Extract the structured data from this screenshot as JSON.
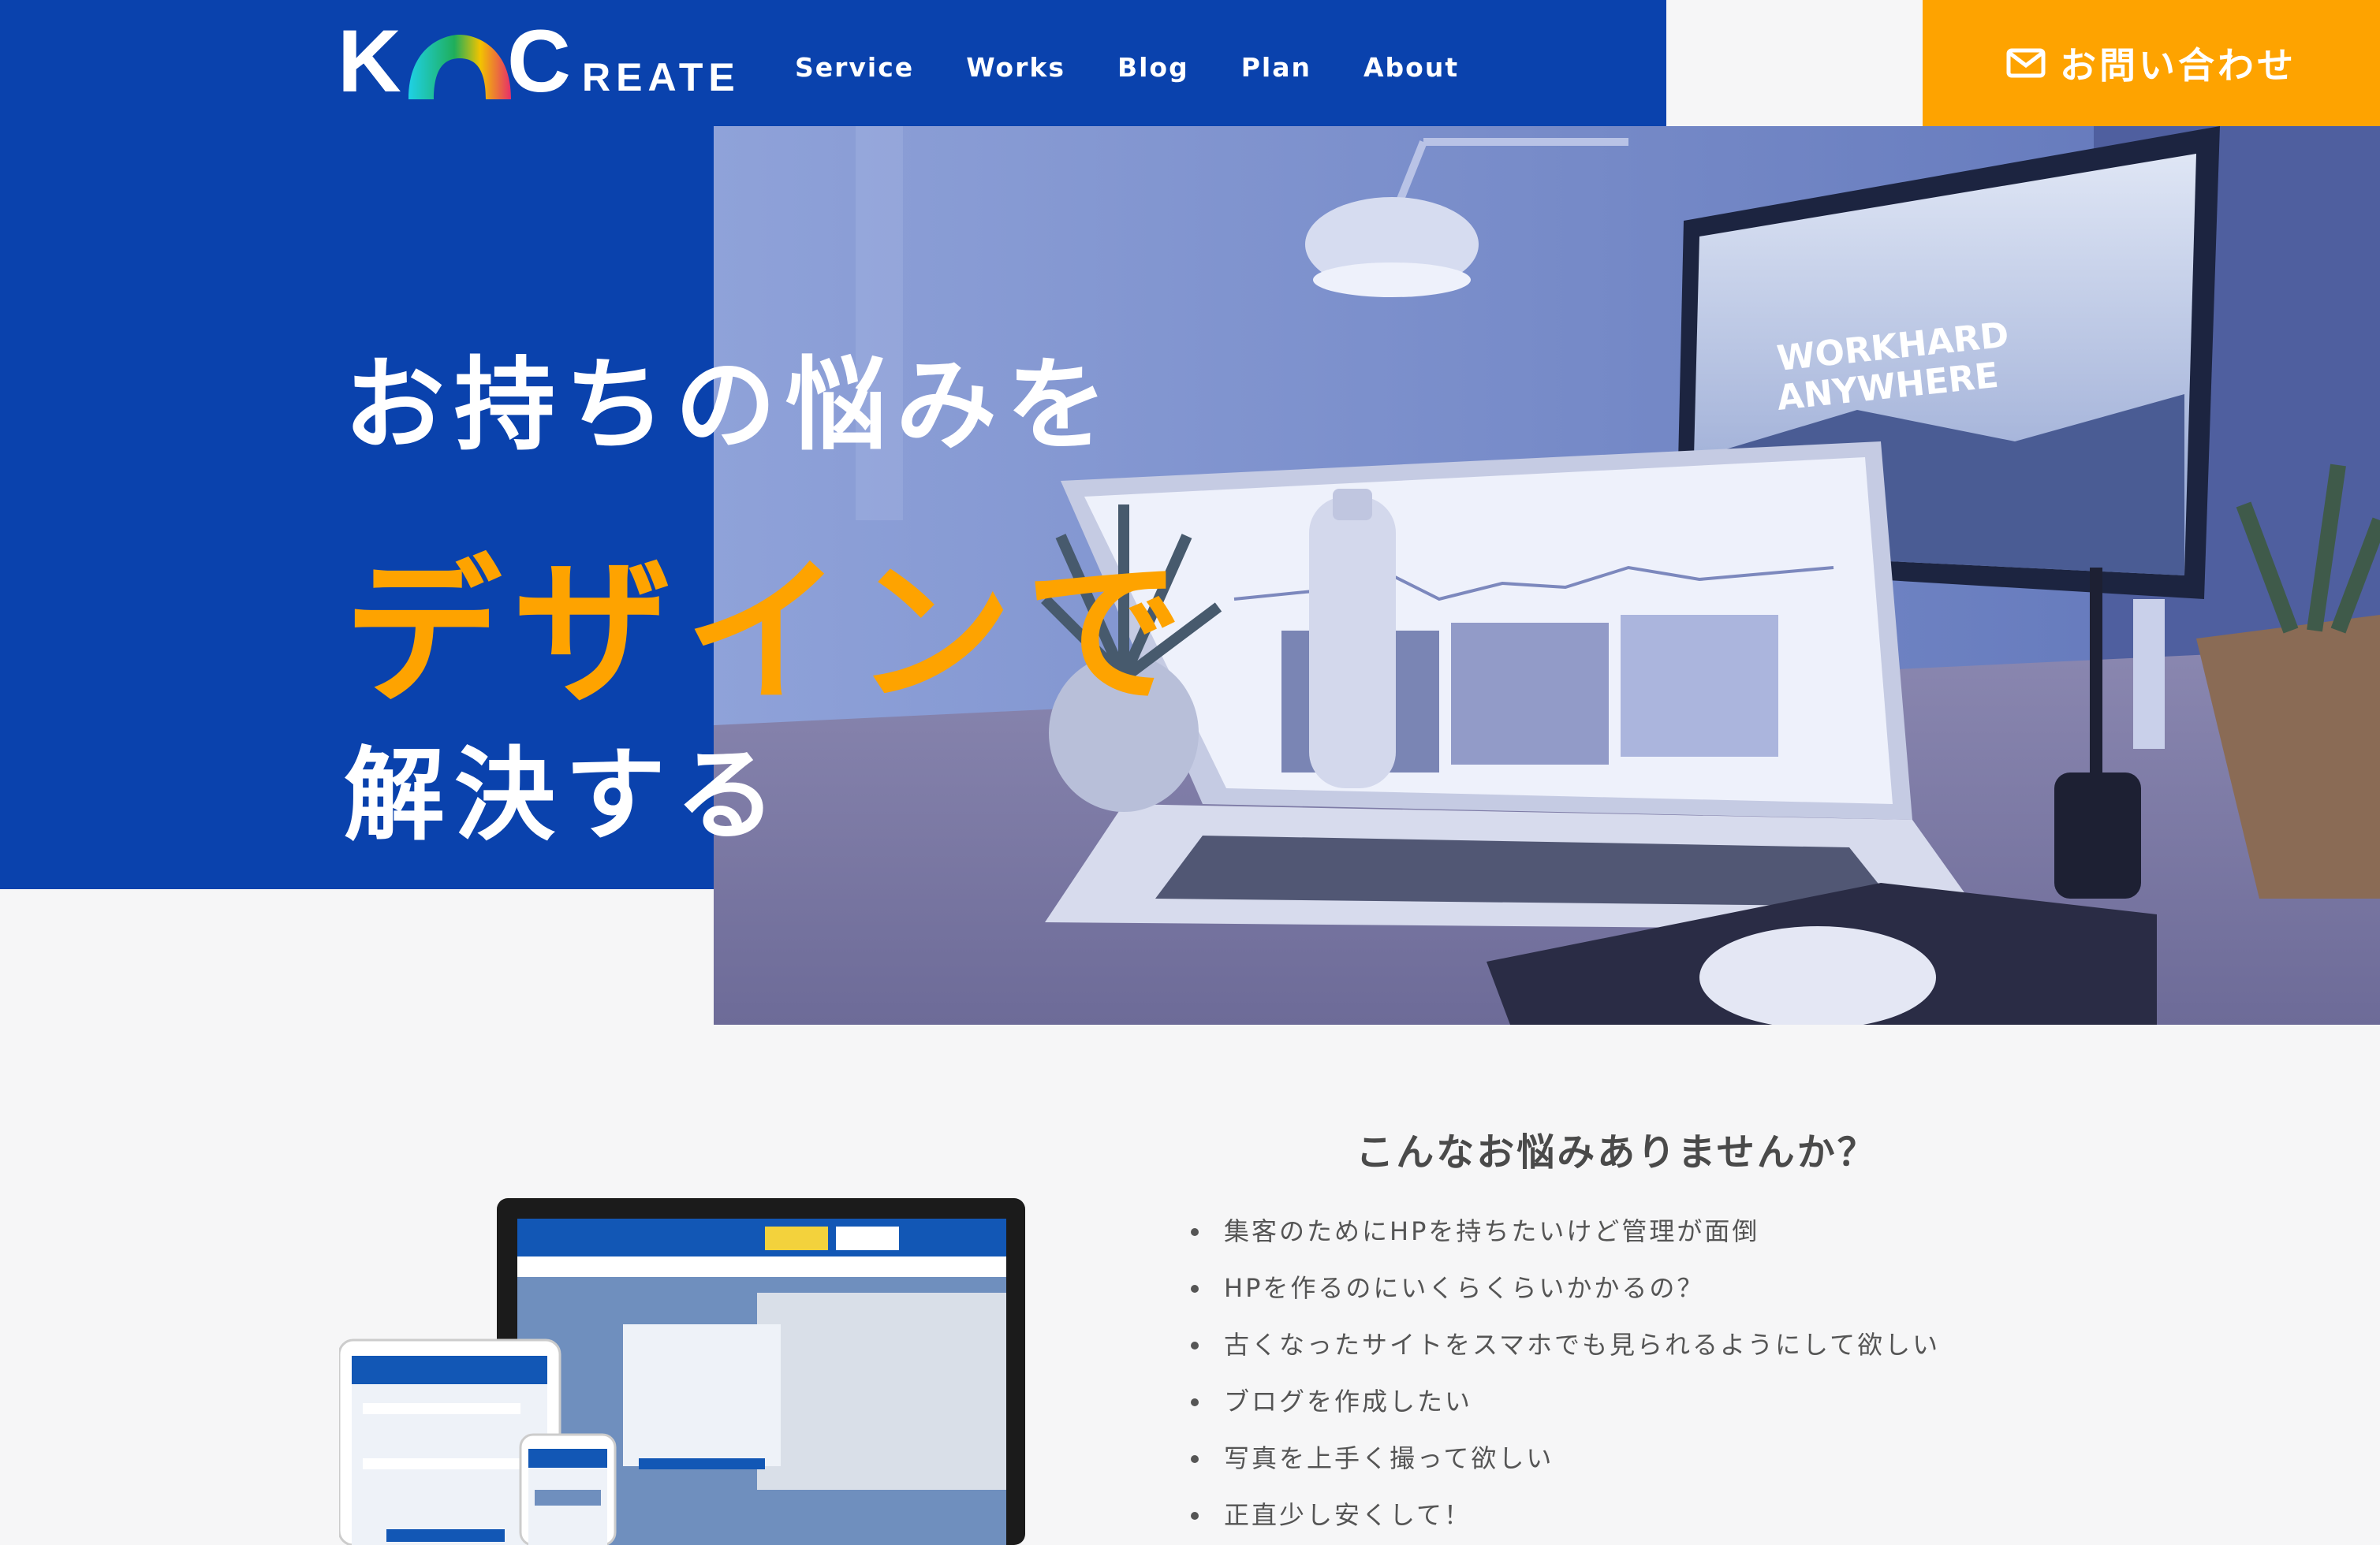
{
  "header": {
    "logo": {
      "k": "K",
      "c": "C",
      "reate": "REATE"
    },
    "nav": [
      "Service",
      "Works",
      "Blog",
      "Plan",
      "About"
    ],
    "contact_label": "お問い合わせ",
    "contact_icon": "mail-icon"
  },
  "hero": {
    "line1": "お持ちの悩みを",
    "line2": "デザインで",
    "line3": "解決する",
    "photo_screen_text": [
      "WORKHARD",
      "ANYWHERE"
    ]
  },
  "worries": {
    "title": "こんなお悩みありませんか？",
    "items": [
      "集客のためにHPを持ちたいけど管理が面倒",
      "HPを作るのにいくらくらいかかるの？",
      "古くなったサイトをスマホでも見られるようにして欲しい",
      "ブログを作成したい",
      "写真を上手く撮って欲しい",
      "正直少し安くして！"
    ]
  },
  "colors": {
    "brand_blue": "#0a42ad",
    "accent_orange": "#fea300",
    "background": "#f6f6f7"
  }
}
